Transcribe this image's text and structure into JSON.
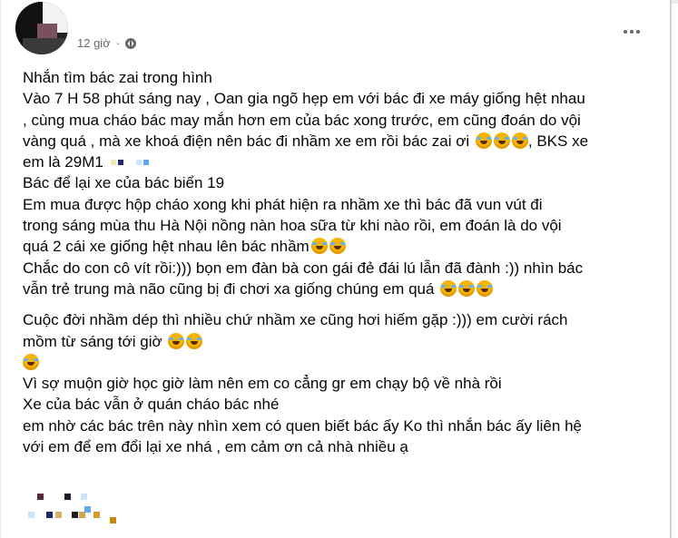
{
  "post": {
    "timestamp": "12 giờ",
    "separator": "·",
    "privacy_icon": "public-globe-icon",
    "more_icon": "more-dots-icon",
    "lines": {
      "l1": "Nhắn tìm  bác zai trong hình",
      "l2": "Vào 7 H 58 phút sáng nay ,  Oan gia ngõ hẹp em với bác đi xe máy giống hệt  nhau",
      "l3": " ,  cùng mua cháo  bác  may mắn hơn em của bác xong trước, em cũng đoán do vội",
      "l4a": "vàng quá , mà xe khoá điện nên  bác đi nhầm xe em rồi  bác zai ơi ",
      "l4b": ", BKS  xe",
      "l5": "em là 29M1",
      "l6": "Bác để lại xe của bác biển 19",
      "l7": "Em mua được hộp cháo  xong  khi  phát hiện ra nhầm xe thì bác đã vun vút  đi",
      "l8": "trong  sáng mùa thu  Hà Nội nồng nàn hoa sữa  từ khi nào rồi, em đoán là do vội",
      "l9": "quá 2 cái xe giống hệt nhau lên bác nhầm",
      "l10": "Chắc do con cô vít rồi:))) bọn em đàn bà con gái đẻ đái lú lẫn đã đành :)) nhìn bác",
      "l11": "vẫn trẻ trung mà não cũng bị đi chơi  xa giống chúng em quá ",
      "l12": " Cuộc đời nhầm dép thì nhiều chứ nhầm xe cũng hơi hiếm gặp :))) em cười rách",
      "l13": "mồm từ sáng tới giờ ",
      "l14": " Vì sợ muộn giờ học giờ làm nên em  co cẳng gr em chạy bộ về nhà rồi",
      "l15": "Xe của bác vẫn ở quán cháo bác nhé",
      "l16": "em nhờ các bác trên này nhìn xem có quen biết bác ấy Ko thì nhắn bác ấy liên hệ",
      "l17": "với em để em đổi lại xe nhá , em cảm ơn cả nhà nhiều ạ"
    },
    "emoji_name": "rolling-on-floor-laughing"
  },
  "colors": {
    "text": "#050505",
    "meta": "#65676b",
    "emoji": "#f4b400"
  }
}
